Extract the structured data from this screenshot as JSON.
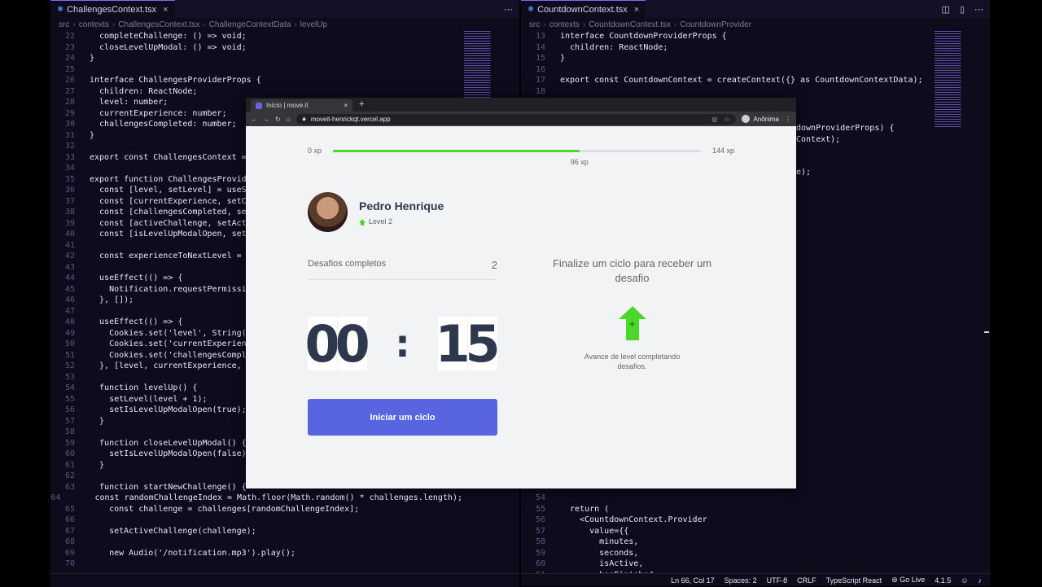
{
  "left_editor": {
    "tab_label": "ChallengesContext.tsx",
    "crumbs": [
      "src",
      "contexts",
      "ChallengesContext.tsx",
      "ChallengeContextData",
      "levelUp"
    ],
    "lines": [
      {
        "n": "22",
        "t": "  completeChallenge: () => void;"
      },
      {
        "n": "23",
        "t": "  closeLevelUpModal: () => void;"
      },
      {
        "n": "24",
        "t": "}"
      },
      {
        "n": "25",
        "t": ""
      },
      {
        "n": "26",
        "t": "interface ChallengesProviderProps {"
      },
      {
        "n": "27",
        "t": "  children: ReactNode;"
      },
      {
        "n": "28",
        "t": "  level: number;"
      },
      {
        "n": "29",
        "t": "  currentExperience: number;"
      },
      {
        "n": "30",
        "t": "  challengesCompleted: number;"
      },
      {
        "n": "31",
        "t": "}"
      },
      {
        "n": "32",
        "t": ""
      },
      {
        "n": "33",
        "t": "export const ChallengesContext = cr"
      },
      {
        "n": "34",
        "t": ""
      },
      {
        "n": "35",
        "t": "export function ChallengesProvider("
      },
      {
        "n": "36",
        "t": "  const [level, setLevel] = useStat"
      },
      {
        "n": "37",
        "t": "  const [currentExperience, setCurr"
      },
      {
        "n": "38",
        "t": "  const [challengesCompleted, setCh"
      },
      {
        "n": "39",
        "t": "  const [activeChallenge, setActive"
      },
      {
        "n": "40",
        "t": "  const [isLevelUpModalOpen, setIsL"
      },
      {
        "n": "41",
        "t": ""
      },
      {
        "n": "42",
        "t": "  const experienceToNextLevel = Mat"
      },
      {
        "n": "43",
        "t": ""
      },
      {
        "n": "44",
        "t": "  useEffect(() => {"
      },
      {
        "n": "45",
        "t": "    Notification.requestPermission("
      },
      {
        "n": "46",
        "t": "  }, []);"
      },
      {
        "n": "47",
        "t": ""
      },
      {
        "n": "48",
        "t": "  useEffect(() => {"
      },
      {
        "n": "49",
        "t": "    Cookies.set('level', String(lev"
      },
      {
        "n": "50",
        "t": "    Cookies.set('currentExperience'"
      },
      {
        "n": "51",
        "t": "    Cookies.set('challengesComplete"
      },
      {
        "n": "52",
        "t": "  }, [level, currentExperience, cha"
      },
      {
        "n": "53",
        "t": ""
      },
      {
        "n": "54",
        "t": "  function levelUp() {"
      },
      {
        "n": "55",
        "t": "    setLevel(level + 1);"
      },
      {
        "n": "56",
        "t": "    setIsLevelUpModalOpen(true);"
      },
      {
        "n": "57",
        "t": "  }"
      },
      {
        "n": "58",
        "t": ""
      },
      {
        "n": "59",
        "t": "  function closeLevelUpModal() {"
      },
      {
        "n": "60",
        "t": "    setIsLevelUpModalOpen(false);"
      },
      {
        "n": "61",
        "t": "  }"
      },
      {
        "n": "62",
        "t": ""
      },
      {
        "n": "63",
        "t": "  function startNewChallenge() {"
      },
      {
        "n": "64",
        "t": "    const randomChallengeIndex = Math.floor(Math.random() * challenges.length);"
      },
      {
        "n": "65",
        "t": "    const challenge = challenges[randomChallengeIndex];"
      },
      {
        "n": "66",
        "t": ""
      },
      {
        "n": "67",
        "t": "    setActiveChallenge(challenge);"
      },
      {
        "n": "68",
        "t": ""
      },
      {
        "n": "69",
        "t": "    new Audio('/notification.mp3').play();"
      },
      {
        "n": "70",
        "t": ""
      }
    ]
  },
  "right_editor": {
    "tab_label": "CountdownContext.tsx",
    "crumbs": [
      "src",
      "contexts",
      "CountdownContext.tsx",
      "CountdownProvider"
    ],
    "lines": [
      {
        "n": "13",
        "t": "interface CountdownProviderProps {"
      },
      {
        "n": "14",
        "t": "  children: ReactNode;"
      },
      {
        "n": "15",
        "t": "}"
      },
      {
        "n": "16",
        "t": ""
      },
      {
        "n": "17",
        "t": "export const CountdownContext = createContext({} as CountdownContextData);"
      },
      {
        "n": "18",
        "t": ""
      }
    ],
    "peek_lines": [
      {
        "t": "downProviderProps) {"
      },
      {
        "t": "Context);"
      },
      {
        "t": ""
      },
      {
        "t": ""
      },
      {
        "t": "e);"
      }
    ],
    "bottom_lines": [
      {
        "n": "54",
        "t": ""
      },
      {
        "n": "55",
        "t": "  return ("
      },
      {
        "n": "56",
        "t": "    <CountdownContext.Provider"
      },
      {
        "n": "57",
        "t": "      value={{"
      },
      {
        "n": "58",
        "t": "        minutes,"
      },
      {
        "n": "59",
        "t": "        seconds,"
      },
      {
        "n": "60",
        "t": "        isActive,"
      },
      {
        "n": "61",
        "t": "        hasFinished,"
      }
    ]
  },
  "status_bar": {
    "position": "Ln 66, Col 17",
    "spaces": "Spaces: 2",
    "encoding": "UTF-8",
    "eol": "CRLF",
    "language": "TypeScript React",
    "golive": "Go Live",
    "version": "4.1.5"
  },
  "browser": {
    "tab_title": "Início | move.it",
    "url": "moveit-henrickqt.vercel.app",
    "profile": "Anônima"
  },
  "app": {
    "xp_min": "0 xp",
    "xp_max": "144 xp",
    "xp_current_label": "96 xp",
    "xp_progress_percent": 67,
    "user_name": "Pedro Henrique",
    "level_label": "Level 2",
    "completed_label": "Desafios completos",
    "completed_count": "2",
    "timer_digits": [
      "0",
      "0",
      "1",
      "5"
    ],
    "timer_colon": ":",
    "cycle_button": "Iniciar um ciclo",
    "challenge_title": "Finalize um ciclo para receber um desafio",
    "challenge_desc": "Avance de level completando desafios.",
    "accent_color": "#5965e0",
    "success_color": "#4cd62b"
  },
  "icons": [
    "close-icon",
    "split-editor-icon",
    "layout-icon",
    "more-icon",
    "back-icon",
    "forward-icon",
    "reload-icon",
    "home-icon",
    "lock-icon",
    "incognito-icon",
    "star-icon",
    "menu-icon",
    "level-up-icon"
  ]
}
